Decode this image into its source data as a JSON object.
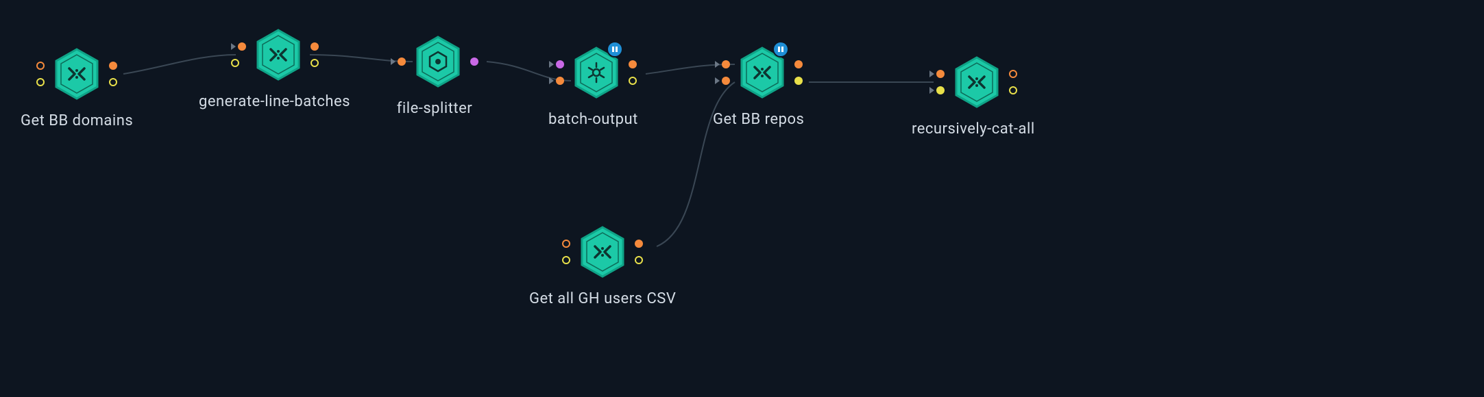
{
  "nodes": {
    "get_bb_domains": {
      "label": "Get BB domains"
    },
    "generate_line_batches": {
      "label": "generate-line-batches"
    },
    "file_splitter": {
      "label": "file-splitter"
    },
    "batch_output": {
      "label": "batch-output"
    },
    "get_bb_repos": {
      "label": "Get BB repos"
    },
    "recursively_cat_all": {
      "label": "recursively-cat-all"
    },
    "get_all_gh_users_csv": {
      "label": "Get all GH users CSV"
    }
  },
  "node_icons": {
    "shell": "shell-icon",
    "splitter": "splitter-icon",
    "batch": "batch-icon"
  },
  "port_colors": {
    "orange": "#f58a3c",
    "yellow": "#e8e04a",
    "purple": "#c969e6"
  },
  "edges": [
    {
      "from": "get_bb_domains",
      "to": "generate_line_batches"
    },
    {
      "from": "generate_line_batches",
      "to": "file_splitter"
    },
    {
      "from": "file_splitter",
      "to": "batch_output"
    },
    {
      "from": "batch_output",
      "to": "get_bb_repos"
    },
    {
      "from": "get_all_gh_users_csv",
      "to": "get_bb_repos"
    },
    {
      "from": "get_bb_repos",
      "to": "recursively_cat_all"
    }
  ]
}
